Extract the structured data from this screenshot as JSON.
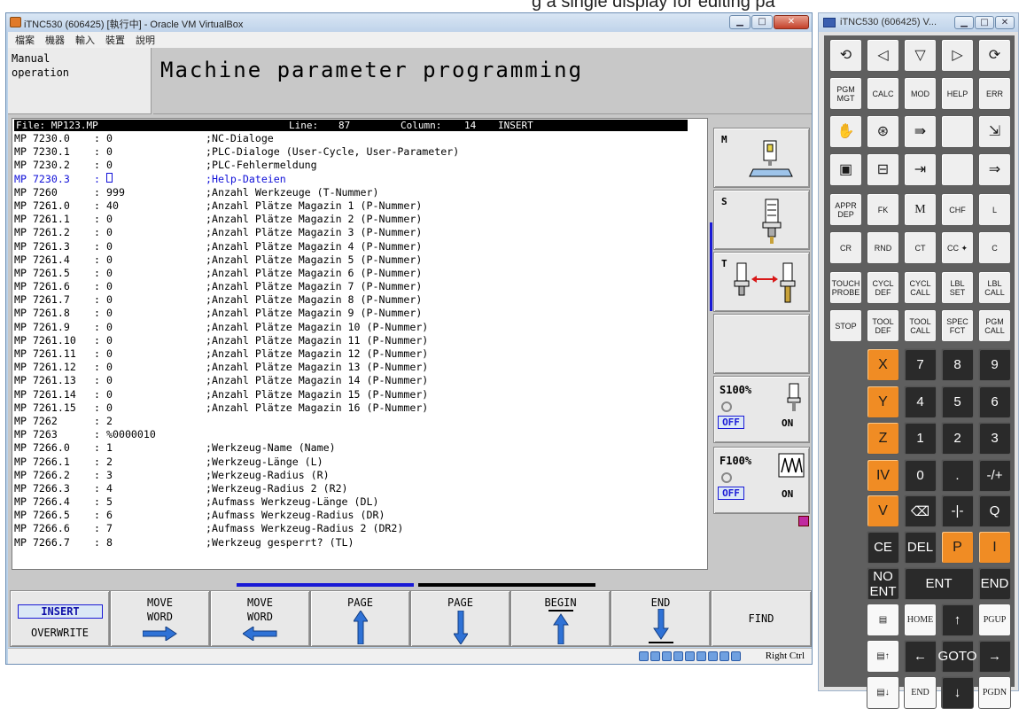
{
  "background_caption": "g a single display for editing pa",
  "vm_window": {
    "title": "iTNC530 (606425) [執行中] - Oracle VM VirtualBox",
    "menu": [
      "檔案",
      "機器",
      "輸入",
      "裝置",
      "說明"
    ],
    "host_key": "Right Ctrl",
    "buttons": {
      "minimize": "▁",
      "maximize": "□",
      "close": "✕"
    }
  },
  "tnc": {
    "mode": "Manual\noperation",
    "title": "Machine parameter programming",
    "file_bar": {
      "file": "File: MP123.MP",
      "line_label": "Line:",
      "line": "87",
      "column_label": "Column:",
      "column": "14",
      "mode": "INSERT"
    },
    "lines": [
      {
        "param": "MP 7230.0",
        "value": "0",
        "comment": ";NC-Dialoge"
      },
      {
        "param": "MP 7230.1",
        "value": "0",
        "comment": ";PLC-Dialoge (User-Cycle, User-Parameter)"
      },
      {
        "param": "MP 7230.2",
        "value": "0",
        "comment": ";PLC-Fehlermeldung"
      },
      {
        "param": "MP 7230.3",
        "value": "0",
        "comment": ";Help-Dateien",
        "active": true
      },
      {
        "param": "MP 7260",
        "value": "999",
        "comment": ";Anzahl Werkzeuge (T-Nummer)"
      },
      {
        "param": "MP 7261.0",
        "value": "40",
        "comment": ";Anzahl Plätze Magazin 1 (P-Nummer)"
      },
      {
        "param": "MP 7261.1",
        "value": "0",
        "comment": ";Anzahl Plätze Magazin 2 (P-Nummer)"
      },
      {
        "param": "MP 7261.2",
        "value": "0",
        "comment": ";Anzahl Plätze Magazin 3 (P-Nummer)"
      },
      {
        "param": "MP 7261.3",
        "value": "0",
        "comment": ";Anzahl Plätze Magazin 4 (P-Nummer)"
      },
      {
        "param": "MP 7261.4",
        "value": "0",
        "comment": ";Anzahl Plätze Magazin 5 (P-Nummer)"
      },
      {
        "param": "MP 7261.5",
        "value": "0",
        "comment": ";Anzahl Plätze Magazin 6 (P-Nummer)"
      },
      {
        "param": "MP 7261.6",
        "value": "0",
        "comment": ";Anzahl Plätze Magazin 7 (P-Nummer)"
      },
      {
        "param": "MP 7261.7",
        "value": "0",
        "comment": ";Anzahl Plätze Magazin 8 (P-Nummer)"
      },
      {
        "param": "MP 7261.8",
        "value": "0",
        "comment": ";Anzahl Plätze Magazin 9 (P-Nummer)"
      },
      {
        "param": "MP 7261.9",
        "value": "0",
        "comment": ";Anzahl Plätze Magazin 10 (P-Nummer)"
      },
      {
        "param": "MP 7261.10",
        "value": "0",
        "comment": ";Anzahl Plätze Magazin 11 (P-Nummer)"
      },
      {
        "param": "MP 7261.11",
        "value": "0",
        "comment": ";Anzahl Plätze Magazin 12 (P-Nummer)"
      },
      {
        "param": "MP 7261.12",
        "value": "0",
        "comment": ";Anzahl Plätze Magazin 13 (P-Nummer)"
      },
      {
        "param": "MP 7261.13",
        "value": "0",
        "comment": ";Anzahl Plätze Magazin 14 (P-Nummer)"
      },
      {
        "param": "MP 7261.14",
        "value": "0",
        "comment": ";Anzahl Plätze Magazin 15 (P-Nummer)"
      },
      {
        "param": "MP 7261.15",
        "value": "0",
        "comment": ";Anzahl Plätze Magazin 16 (P-Nummer)"
      },
      {
        "param": "MP 7262",
        "value": "2",
        "comment": ""
      },
      {
        "param": "MP 7263",
        "value": "%0000010",
        "comment": ""
      },
      {
        "param": "MP 7266.0",
        "value": "1",
        "comment": ";Werkzeug-Name (Name)"
      },
      {
        "param": "MP 7266.1",
        "value": "2",
        "comment": ";Werkzeug-Länge (L)"
      },
      {
        "param": "MP 7266.2",
        "value": "3",
        "comment": ";Werkzeug-Radius (R)"
      },
      {
        "param": "MP 7266.3",
        "value": "4",
        "comment": ";Werkzeug-Radius 2 (R2)"
      },
      {
        "param": "MP 7266.4",
        "value": "5",
        "comment": ";Aufmass Werkzeug-Länge (DL)"
      },
      {
        "param": "MP 7266.5",
        "value": "6",
        "comment": ";Aufmass Werkzeug-Radius (DR)"
      },
      {
        "param": "MP 7266.6",
        "value": "7",
        "comment": ";Aufmass Werkzeug-Radius 2 (DR2)"
      },
      {
        "param": "MP 7266.7",
        "value": "8",
        "comment": ";Werkzeug gesperrt? (TL)"
      }
    ],
    "right_softkeys": {
      "m": "M",
      "s": "S",
      "t": "T",
      "spindle_override": "S100%",
      "feed_override": "F100%",
      "off": "OFF",
      "on": "ON"
    },
    "bottom_softkeys": {
      "insert": "INSERT",
      "overwrite": "OVERWRITE",
      "move_word_right": [
        "MOVE",
        "WORD"
      ],
      "move_word_left": [
        "MOVE",
        "WORD"
      ],
      "page_up": "PAGE",
      "page_down": "PAGE",
      "begin": "BEGIN",
      "end": "END",
      "find": "FIND"
    }
  },
  "keypad_window": {
    "title": "iTNC530 (606425) V...",
    "rows": [
      [
        {
          "t": "⟲",
          "s": "gray big",
          "n": "rotate-left-key"
        },
        {
          "t": "◁",
          "s": "gray big",
          "n": "arrow-left-key"
        },
        {
          "t": "▽",
          "s": "gray big",
          "n": "arrow-down-key"
        },
        {
          "t": "▷",
          "s": "gray big",
          "n": "arrow-right-key"
        },
        {
          "t": "⟳",
          "s": "gray big",
          "n": "rotate-right-key"
        }
      ],
      [
        {
          "t": "PGM MGT",
          "s": "gray",
          "n": "pgm-mgt-key"
        },
        {
          "t": "CALC",
          "s": "gray",
          "n": "calc-key"
        },
        {
          "t": "MOD",
          "s": "gray",
          "n": "mod-key"
        },
        {
          "t": "HELP",
          "s": "gray",
          "n": "help-key"
        },
        {
          "t": "ERR",
          "s": "gray",
          "n": "err-key"
        }
      ],
      [
        {
          "t": "✋",
          "s": "gray big",
          "n": "manual-mode-key"
        },
        {
          "t": "⊛",
          "s": "gray big",
          "n": "handwheel-key"
        },
        {
          "t": "⇛",
          "s": "gray big",
          "n": "positioning-key"
        },
        {
          "t": "",
          "s": "gray",
          "n": "blank-key"
        },
        {
          "t": "⇲",
          "s": "gray big",
          "n": "test-run-key"
        }
      ],
      [
        {
          "t": "▣",
          "s": "gray big",
          "n": "program-run-single-key"
        },
        {
          "t": "⊟",
          "s": "gray big",
          "n": "program-run-full-key"
        },
        {
          "t": "⇥",
          "s": "gray big",
          "n": "programming-key"
        },
        {
          "t": "",
          "s": "gray",
          "n": "blank-key-2"
        },
        {
          "t": "⇒",
          "s": "gray big",
          "n": "smart-key"
        }
      ],
      [
        {
          "t": "APPR DEP",
          "s": "gray",
          "n": "appr-dep-key"
        },
        {
          "t": "FK",
          "s": "gray",
          "n": "fk-key"
        },
        {
          "t": "M",
          "s": "gray serif",
          "n": "m-key"
        },
        {
          "t": "CHF",
          "s": "gray",
          "n": "chf-key"
        },
        {
          "t": "L",
          "s": "gray",
          "n": "line-key"
        }
      ],
      [
        {
          "t": "CR",
          "s": "gray",
          "n": "cr-key"
        },
        {
          "t": "RND",
          "s": "gray",
          "n": "rnd-key"
        },
        {
          "t": "CT",
          "s": "gray",
          "n": "ct-key"
        },
        {
          "t": "CC ✦",
          "s": "gray",
          "n": "cc-key"
        },
        {
          "t": "C",
          "s": "gray",
          "n": "circle-key"
        }
      ],
      [
        {
          "t": "TOUCH PROBE",
          "s": "gray",
          "n": "touch-probe-key"
        },
        {
          "t": "CYCL DEF",
          "s": "gray",
          "n": "cycl-def-key"
        },
        {
          "t": "CYCL CALL",
          "s": "gray",
          "n": "cycl-call-key"
        },
        {
          "t": "LBL SET",
          "s": "gray",
          "n": "lbl-set-key"
        },
        {
          "t": "LBL CALL",
          "s": "gray",
          "n": "lbl-call-key"
        }
      ],
      [
        {
          "t": "STOP",
          "s": "gray",
          "n": "stop-key"
        },
        {
          "t": "TOOL DEF",
          "s": "gray",
          "n": "tool-def-key"
        },
        {
          "t": "TOOL CALL",
          "s": "gray",
          "n": "tool-call-key"
        },
        {
          "t": "SPEC FCT",
          "s": "gray",
          "n": "spec-fct-key"
        },
        {
          "t": "PGM CALL",
          "s": "gray",
          "n": "pgm-call-key"
        }
      ],
      [
        {
          "t": "",
          "s": "none",
          "n": "empty"
        },
        {
          "t": "X",
          "s": "orange",
          "n": "axis-x-key"
        },
        {
          "t": "7",
          "s": "dark",
          "n": "digit-7-key"
        },
        {
          "t": "8",
          "s": "dark",
          "n": "digit-8-key"
        },
        {
          "t": "9",
          "s": "dark",
          "n": "digit-9-key"
        }
      ],
      [
        {
          "t": "",
          "s": "none",
          "n": "empty"
        },
        {
          "t": "Y",
          "s": "orange",
          "n": "axis-y-key"
        },
        {
          "t": "4",
          "s": "dark",
          "n": "digit-4-key"
        },
        {
          "t": "5",
          "s": "dark",
          "n": "digit-5-key"
        },
        {
          "t": "6",
          "s": "dark",
          "n": "digit-6-key"
        }
      ],
      [
        {
          "t": "",
          "s": "none",
          "n": "empty"
        },
        {
          "t": "Z",
          "s": "orange",
          "n": "axis-z-key"
        },
        {
          "t": "1",
          "s": "dark",
          "n": "digit-1-key"
        },
        {
          "t": "2",
          "s": "dark",
          "n": "digit-2-key"
        },
        {
          "t": "3",
          "s": "dark",
          "n": "digit-3-key"
        }
      ],
      [
        {
          "t": "",
          "s": "none",
          "n": "empty"
        },
        {
          "t": "IV",
          "s": "orange",
          "n": "axis-iv-key"
        },
        {
          "t": "0",
          "s": "dark",
          "n": "digit-0-key"
        },
        {
          "t": ".",
          "s": "dark",
          "n": "decimal-key"
        },
        {
          "t": "-/+",
          "s": "dark",
          "n": "sign-key"
        }
      ],
      [
        {
          "t": "",
          "s": "none",
          "n": "empty"
        },
        {
          "t": "V",
          "s": "orange",
          "n": "axis-v-key"
        },
        {
          "t": "⌫",
          "s": "dark",
          "n": "backspace-key"
        },
        {
          "t": "-|-",
          "s": "dark",
          "n": "actual-position-key"
        },
        {
          "t": "Q",
          "s": "dark",
          "n": "q-key"
        }
      ],
      [
        {
          "t": "",
          "s": "none",
          "n": "empty"
        },
        {
          "t": "CE",
          "s": "dark",
          "n": "ce-key"
        },
        {
          "t": "DEL",
          "s": "dark",
          "n": "del-key"
        },
        {
          "t": "P",
          "s": "orange",
          "n": "p-key"
        },
        {
          "t": "I",
          "s": "orange",
          "n": "i-key"
        }
      ],
      [
        {
          "t": "",
          "s": "none",
          "n": "empty"
        },
        {
          "t": "NO ENT",
          "s": "dark",
          "n": "no-ent-key"
        },
        {
          "t": "ENT",
          "s": "dark wide",
          "n": "ent-key"
        },
        {
          "t": "",
          "s": "skip",
          "n": "skip"
        },
        {
          "t": "END",
          "s": "dark",
          "n": "end-key"
        }
      ],
      [
        {
          "t": "",
          "s": "none",
          "n": "empty"
        },
        {
          "t": "▤",
          "s": "white",
          "n": "page-icon-key"
        },
        {
          "t": "HOME",
          "s": "white",
          "n": "home-key"
        },
        {
          "t": "↑",
          "s": "dark",
          "n": "cursor-up-key"
        },
        {
          "t": "PGUP",
          "s": "white",
          "n": "pgup-key"
        }
      ],
      [
        {
          "t": "",
          "s": "none",
          "n": "empty"
        },
        {
          "t": "▤↑",
          "s": "white",
          "n": "softkey-up-key"
        },
        {
          "t": "←",
          "s": "dark",
          "n": "cursor-left-key"
        },
        {
          "t": "GOTO",
          "s": "dark",
          "n": "goto-key"
        },
        {
          "t": "→",
          "s": "dark",
          "n": "cursor-right-key"
        }
      ],
      [
        {
          "t": "",
          "s": "none",
          "n": "empty"
        },
        {
          "t": "▤↓",
          "s": "white",
          "n": "softkey-down-key"
        },
        {
          "t": "END",
          "s": "white",
          "n": "end-nav-key"
        },
        {
          "t": "↓",
          "s": "dark",
          "n": "cursor-down-key"
        },
        {
          "t": "PGDN",
          "s": "white",
          "n": "pgdn-key"
        }
      ]
    ]
  }
}
